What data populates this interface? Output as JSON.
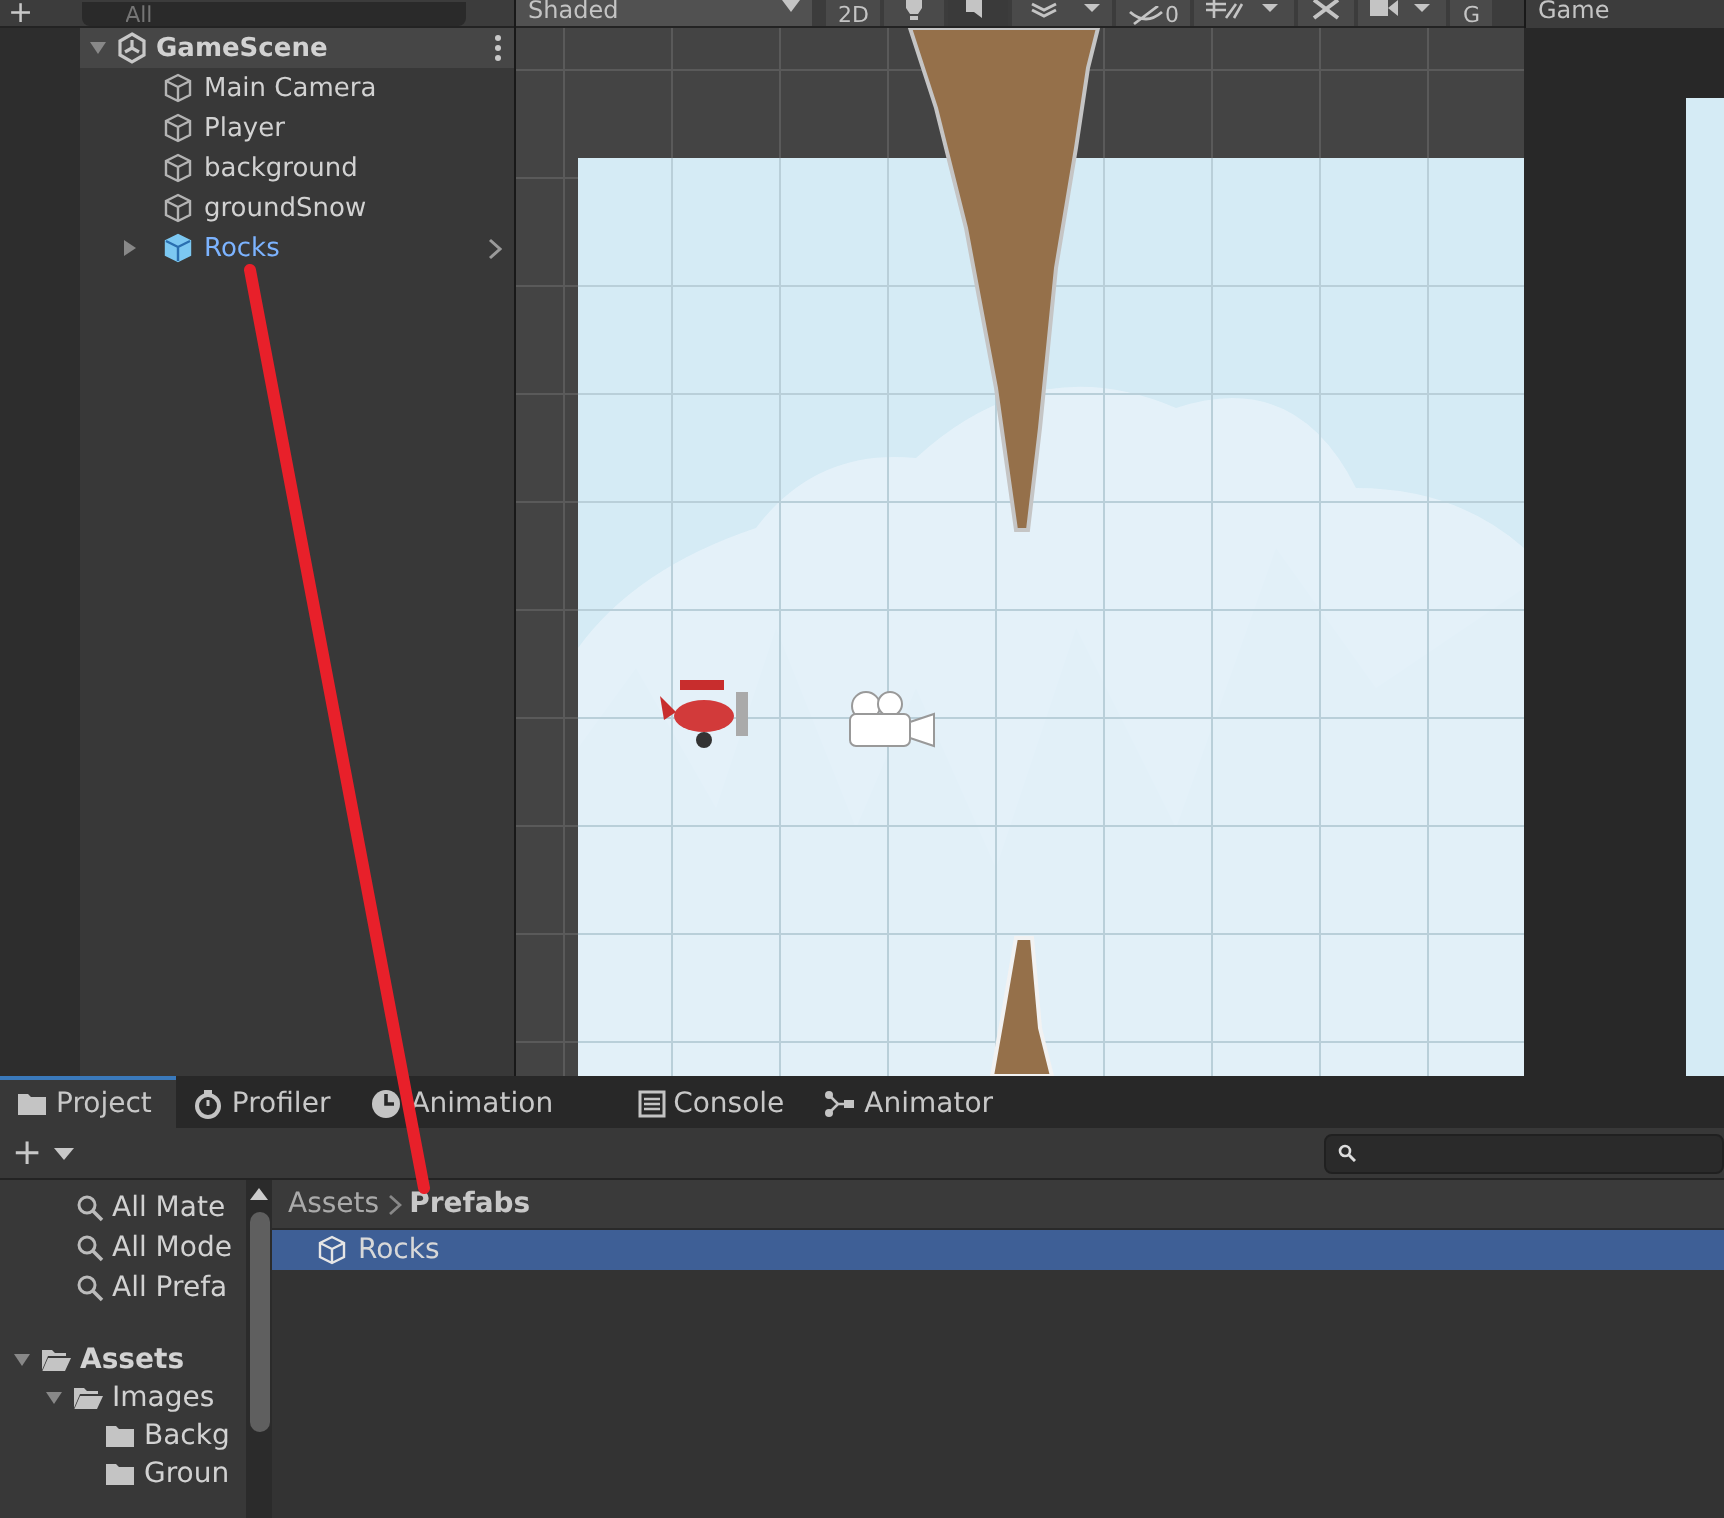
{
  "hierarchy": {
    "toolbar": {
      "add": "+",
      "search_placeholder": "All"
    },
    "scene": {
      "name": "GameScene",
      "expanded": true,
      "children": [
        {
          "name": "Main Camera",
          "kind": "object"
        },
        {
          "name": "Player",
          "kind": "object"
        },
        {
          "name": "background",
          "kind": "object"
        },
        {
          "name": "groundSnow",
          "kind": "object"
        },
        {
          "name": "Rocks",
          "kind": "prefab",
          "expanded": false
        }
      ]
    }
  },
  "scene_view": {
    "toolbar": {
      "shading": "Shaded",
      "view_2d": "2D",
      "hidden_count": "0",
      "gizmos": "G"
    }
  },
  "game_view": {
    "title": "Game"
  },
  "bottom_tabs": [
    {
      "label": "Project",
      "selected": true,
      "kind": "project"
    },
    {
      "label": "Profiler",
      "selected": false,
      "kind": "profiler"
    },
    {
      "label": "Animation",
      "selected": false,
      "kind": "animation"
    },
    {
      "label": "Console",
      "selected": false,
      "kind": "console"
    },
    {
      "label": "Animator",
      "selected": false,
      "kind": "animator"
    }
  ],
  "project": {
    "add": "+",
    "favorites": [
      "All Mate",
      "All Mode",
      "All Prefa"
    ],
    "tree": [
      {
        "name": "Assets",
        "expanded": true,
        "children": [
          {
            "name": "Images",
            "expanded": true,
            "children": [
              {
                "name": "Backg"
              },
              {
                "name": "Groun"
              }
            ]
          }
        ]
      }
    ],
    "breadcrumb": [
      "Assets",
      "Prefabs"
    ],
    "files": [
      {
        "name": "Rocks",
        "selected": true
      }
    ]
  }
}
